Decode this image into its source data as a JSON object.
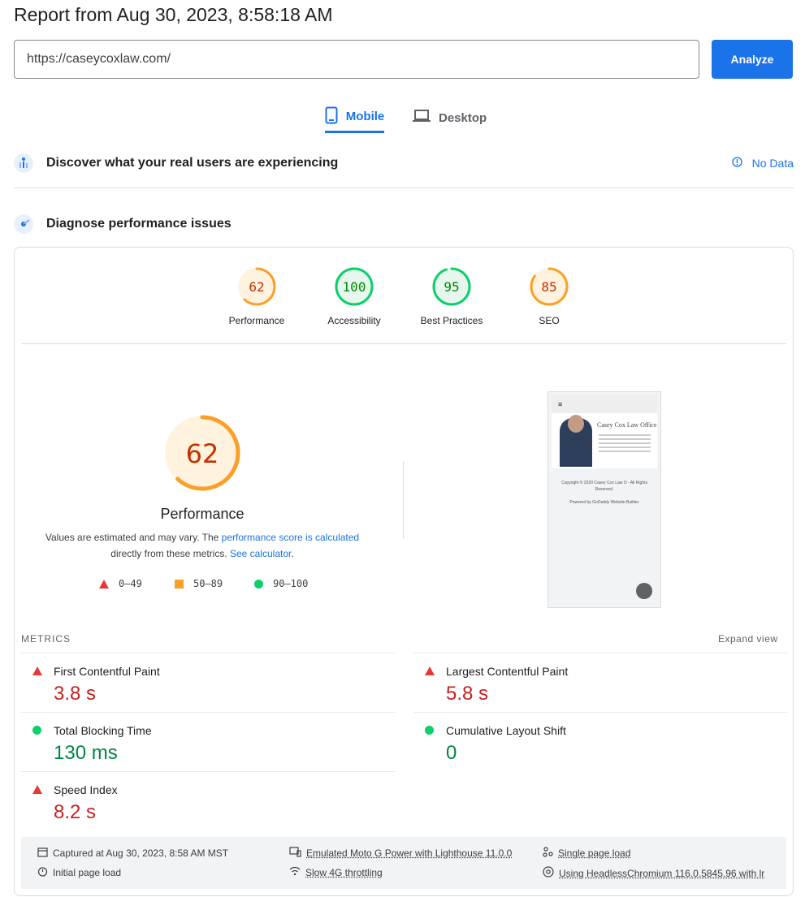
{
  "report_title": "Report from Aug 30, 2023, 8:58:18 AM",
  "url_input": {
    "value": "https://caseycoxlaw.com/"
  },
  "analyze_label": "Analyze",
  "tabs": {
    "mobile": "Mobile",
    "desktop": "Desktop"
  },
  "crux": {
    "title": "Discover what your real users are experiencing",
    "status": "No Data"
  },
  "diagnose": {
    "title": "Diagnose performance issues"
  },
  "scores": [
    {
      "label": "Performance",
      "value": "62",
      "fraction": 0.62,
      "color": "#fa9f27",
      "text_color": "#c33300"
    },
    {
      "label": "Accessibility",
      "value": "100",
      "fraction": 1.0,
      "color": "#0cce6b",
      "text_color": "#008800"
    },
    {
      "label": "Best Practices",
      "value": "95",
      "fraction": 0.95,
      "color": "#0cce6b",
      "text_color": "#008800"
    },
    {
      "label": "SEO",
      "value": "85",
      "fraction": 0.85,
      "color": "#fa9f27",
      "text_color": "#c33300"
    }
  ],
  "performance": {
    "score": "62",
    "fraction": 0.62,
    "title": "Performance",
    "desc_1": "Values are estimated and may vary. The ",
    "desc_link_1": "performance score is calculated",
    "desc_2": " directly from these metrics. ",
    "desc_link_2": "See calculator",
    "desc_3": "."
  },
  "legend": {
    "fail": "0–49",
    "average": "50–89",
    "pass": "90–100"
  },
  "screenshot": {
    "menu": "≡",
    "brand": "Casey Cox Law Office",
    "copyright": "Copyright © 2020 Casey Cox Law O - All Rights Reserved.",
    "powered": "Powered by GoDaddy Website Builder"
  },
  "metrics_heading": "METRICS",
  "expand_view": "Expand view",
  "metrics": {
    "fcp": {
      "name": "First Contentful Paint",
      "value": "3.8 s",
      "status": "fail"
    },
    "lcp": {
      "name": "Largest Contentful Paint",
      "value": "5.8 s",
      "status": "fail"
    },
    "tbt": {
      "name": "Total Blocking Time",
      "value": "130 ms",
      "status": "pass"
    },
    "cls": {
      "name": "Cumulative Layout Shift",
      "value": "0",
      "status": "pass"
    },
    "si": {
      "name": "Speed Index",
      "value": "8.2 s",
      "status": "fail"
    }
  },
  "footer": {
    "captured": "Captured at Aug 30, 2023, 8:58 AM MST",
    "initial": "Initial page load",
    "emulated": "Emulated Moto G Power with Lighthouse 11.0.0",
    "throttling": "Slow 4G throttling",
    "single": "Single page load",
    "browser": "Using HeadlessChromium 116.0.5845.96 with lr"
  }
}
